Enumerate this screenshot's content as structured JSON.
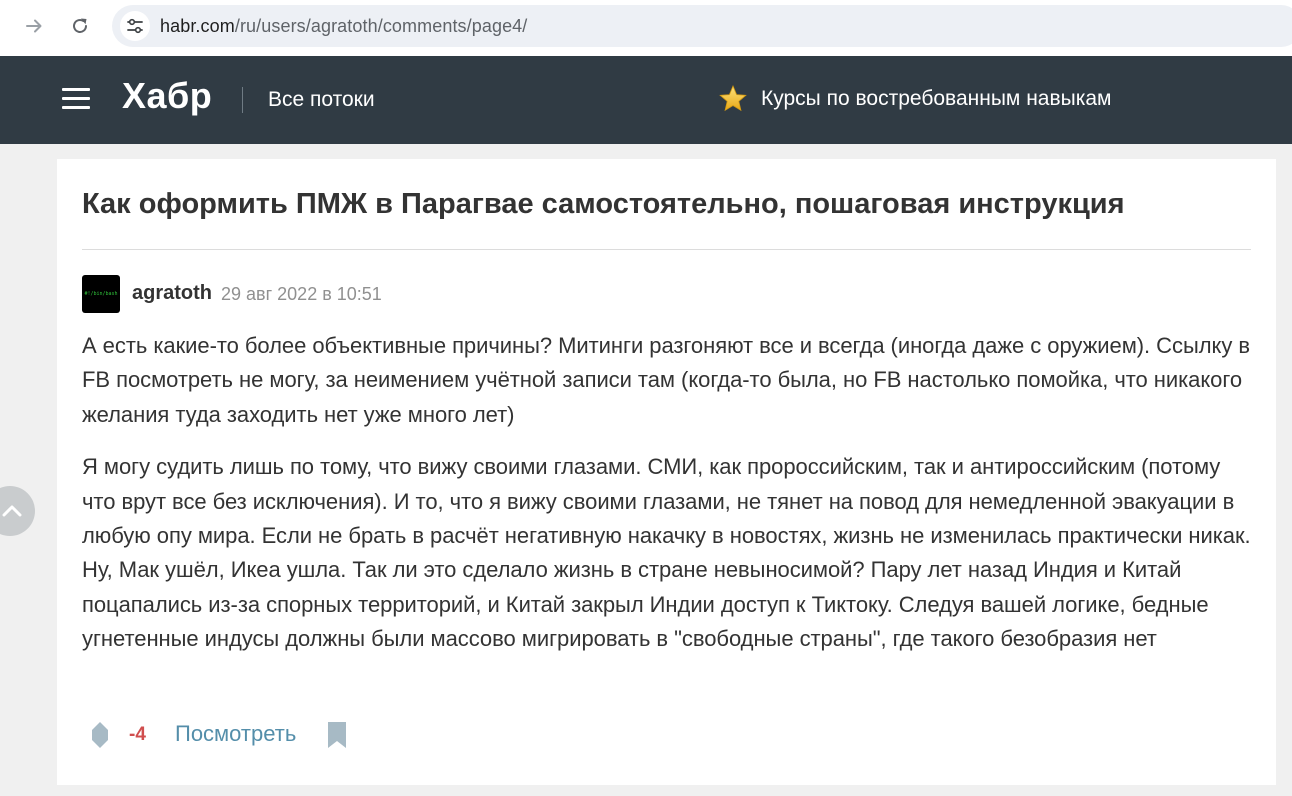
{
  "browser": {
    "url_host": "habr.com",
    "url_path": "/ru/users/agratoth/comments/page4/"
  },
  "header": {
    "logo": "Хабр",
    "all_flows": "Все потоки",
    "courses": "Курсы по востребованным навыкам"
  },
  "post": {
    "title": "Как оформить ПМЖ в Парагвае самостоятельно, пошаговая инструкция"
  },
  "comment": {
    "avatar_text": "#!/bin/bash",
    "author": "agratoth",
    "date": "29 авг 2022 в 10:51",
    "paragraphs": [
      "А есть какие-то более объективные причины? Митинги разгоняют все и всегда (иногда даже с оружием). Ссылку в FB посмотреть не могу, за неимением учётной записи там (когда-то была, но FB настолько помойка, что никакого желания туда заходить нет уже много лет)",
      "Я могу судить лишь по тому, что вижу своими глазами. СМИ, как пророссийским, так и антироссийским (потому что врут все без исключения). И то, что я вижу своими глазами, не тянет на повод для немедленной эвакуации в любую опу мира. Если не брать в расчёт негативную накачку в новостях, жизнь не изменилась практически никак. Ну, Мак ушёл, Икеа ушла. Так ли это сделало жизнь в стране невыносимой? Пару лет назад Индия и Китай поцапались из-за спорных территорий, и Китай закрыл Индии доступ к Тиктоку. Следуя вашей логике, бедные угнетенные индусы должны были массово мигрировать в \"свободные страны\", где такого безобразия нет"
    ],
    "score": "-4",
    "view_label": "Посмотреть"
  },
  "icons": {
    "forward": "arrow-right-icon",
    "reload": "reload-icon",
    "site_info": "tune-icon",
    "menu": "hamburger-icon",
    "courses": "star-icon",
    "vote": "diamond-vote-icon",
    "bookmark": "bookmark-icon",
    "scroll_up": "chevron-up-icon"
  },
  "colors": {
    "header_bg": "#303b44",
    "score_negative": "#d04e4e",
    "link": "#548eaa",
    "star": "#f2c12e"
  }
}
